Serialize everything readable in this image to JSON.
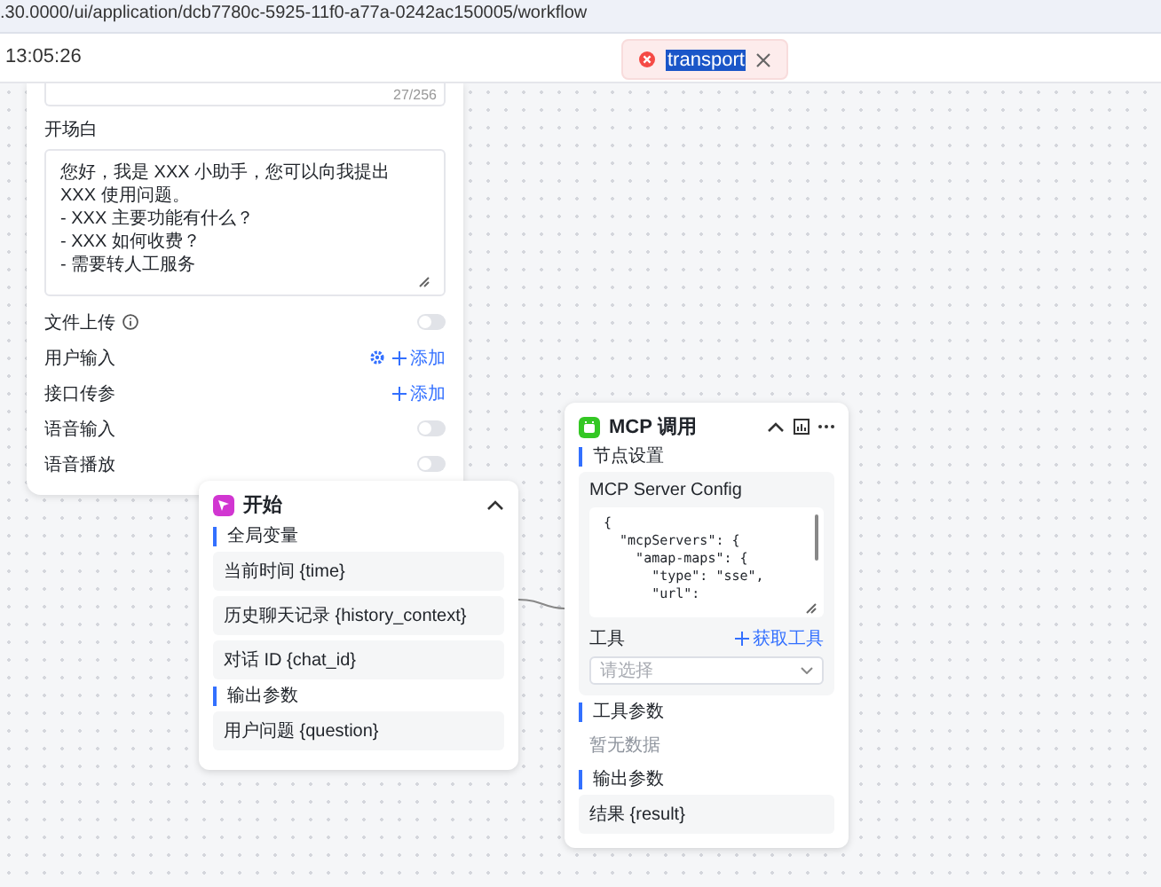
{
  "url_bar": {
    "url": ".30.0000/ui/application/dcb7780c-5925-11f0-a77a-0242ac150005/workflow"
  },
  "header": {
    "time": "13:05:26"
  },
  "toast": {
    "message": "transport"
  },
  "settings_panel": {
    "counter": "27/256",
    "greeting_label": "开场白",
    "greeting_text": "您好，我是 XXX 小助手，您可以向我提出 XXX 使用问题。\n- XXX 主要功能有什么？\n- XXX 如何收费？\n- 需要转人工服务",
    "rows": [
      {
        "kind": "toggle",
        "label": "文件上传",
        "info": true,
        "on": false
      },
      {
        "kind": "add",
        "label": "用户输入",
        "gear": true,
        "action": "添加"
      },
      {
        "kind": "add",
        "label": "接口传参",
        "gear": false,
        "action": "添加"
      },
      {
        "kind": "toggle",
        "label": "语音输入",
        "info": false,
        "on": false
      },
      {
        "kind": "toggle",
        "label": "语音播放",
        "info": false,
        "on": false
      }
    ]
  },
  "start_node": {
    "title": "开始",
    "sections": [
      {
        "title": "全局变量",
        "items": [
          "当前时间 {time}",
          "历史聊天记录 {history_context}",
          "对话 ID {chat_id}"
        ]
      },
      {
        "title": "输出参数",
        "items": [
          "用户问题 {question}"
        ]
      }
    ]
  },
  "mcp_node": {
    "title": "MCP 调用",
    "section_title": "节点设置",
    "config_label": "MCP Server Config",
    "config_code": [
      "{",
      "  \"mcpServers\": {",
      "    \"amap-maps\": {",
      "      \"type\": \"sse\",",
      "      \"url\":"
    ],
    "tools_label": "工具",
    "tools_action": "获取工具",
    "tools_select": {
      "placeholder": "请选择"
    },
    "params_title": "工具参数",
    "params_empty": "暂无数据",
    "output_title": "输出参数",
    "outputs": [
      "结果 {result}"
    ]
  }
}
